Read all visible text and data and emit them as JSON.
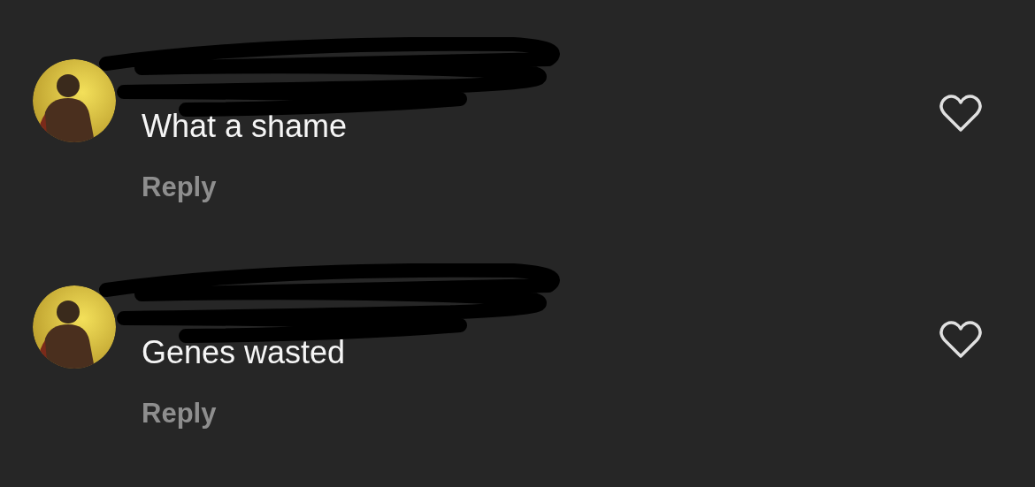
{
  "comments": [
    {
      "text": "What a shame",
      "reply": "Reply",
      "liked": false
    },
    {
      "text": "Genes wasted",
      "reply": "Reply",
      "liked": false
    }
  ]
}
